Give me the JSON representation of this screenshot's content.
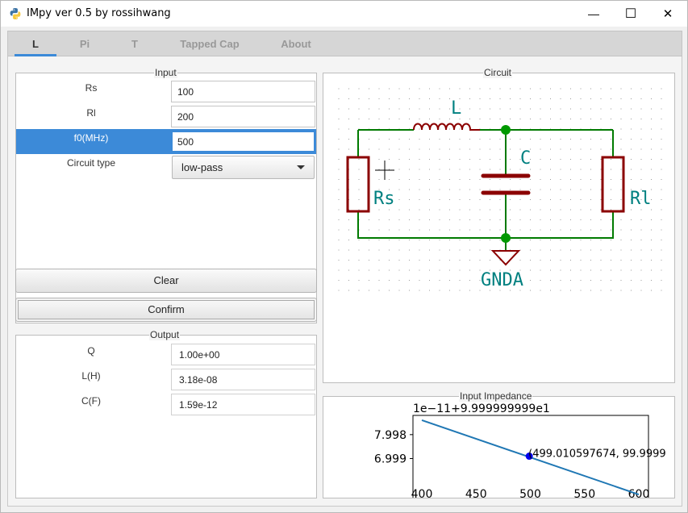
{
  "window": {
    "title": "IMpy ver 0.5 by rossihwang",
    "controls": {
      "minimize": "—",
      "maximize": "☐",
      "close": "✕"
    }
  },
  "tabs": [
    {
      "label": "L",
      "active": true
    },
    {
      "label": "Pi",
      "active": false
    },
    {
      "label": "T",
      "active": false
    },
    {
      "label": "Tapped Cap",
      "active": false
    },
    {
      "label": "About",
      "active": false
    }
  ],
  "input": {
    "title": "Input",
    "rs_label": "Rs",
    "rs_value": "100",
    "rl_label": "Rl",
    "rl_value": "200",
    "f0_label": "f0(MHz)",
    "f0_value": "500",
    "circuit_type_label": "Circuit type",
    "circuit_type_value": "low-pass"
  },
  "buttons": {
    "clear": "Clear",
    "confirm": "Confirm"
  },
  "output": {
    "title": "Output",
    "q_label": "Q",
    "q_value": "1.00e+00",
    "l_label": "L(H)",
    "l_value": "3.18e-08",
    "c_label": "C(F)",
    "c_value": "1.59e-12"
  },
  "circuit": {
    "title": "Circuit",
    "inductor_label": "L",
    "capacitor_label": "C",
    "source_resistor_label": "Rs",
    "load_resistor_label": "Rl",
    "ground_label": "GNDA",
    "colors": {
      "wire": "#007a00",
      "component": "#8b0000",
      "text": "#008080",
      "junction": "#009900"
    }
  },
  "impedance": {
    "title": "Input Impedance",
    "offset_label": "1e−11+9.999999999e1",
    "annotation": "(499.010597674, 99.9999",
    "colors": {
      "line": "#1f77b4",
      "marker": "#0000ee"
    }
  },
  "chart_data": {
    "type": "line",
    "title": "",
    "xlabel": "",
    "ylabel": "",
    "x": [
      400,
      600
    ],
    "series": [
      {
        "values": [
          8.6,
          5.5
        ]
      }
    ],
    "marker": {
      "x": 499.010597674,
      "y": 7.1
    },
    "xlim": [
      400,
      600
    ],
    "ylim": [
      5.3,
      8.8
    ],
    "xticks": [
      "400",
      "450",
      "500",
      "550",
      "600"
    ],
    "xtick_values": [
      400,
      450,
      500,
      550,
      600
    ],
    "yticks": [
      "7.998",
      "6.999"
    ],
    "ytick_values": [
      7.998,
      6.999
    ],
    "grid": false
  }
}
